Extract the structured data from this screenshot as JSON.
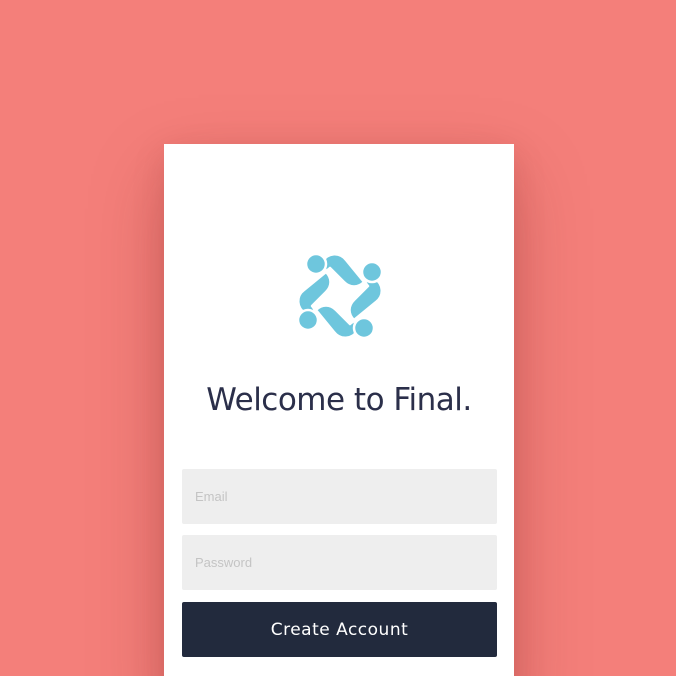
{
  "brand": {
    "logo_icon": "final-logo-icon",
    "logo_color": "#6ec6dd"
  },
  "welcome": {
    "title": "Welcome to Final."
  },
  "form": {
    "email_placeholder": "Email",
    "email_value": "",
    "password_placeholder": "Password",
    "password_value": "",
    "submit_label": "Create Account"
  },
  "colors": {
    "background": "#f47f7a",
    "card": "#ffffff",
    "input_bg": "#eeeeee",
    "button_bg": "#222a3d",
    "title_text": "#2b2f4a"
  }
}
